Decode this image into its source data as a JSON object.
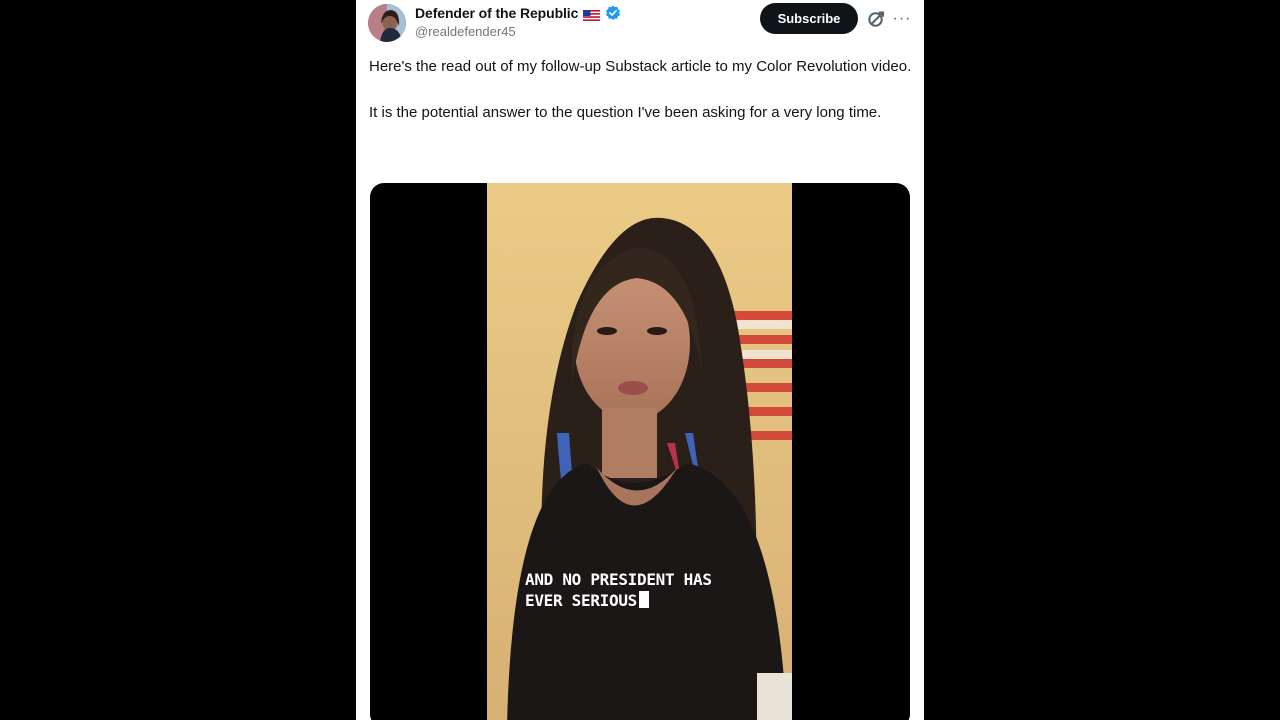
{
  "tweet": {
    "author": {
      "name": "Defender of the Republic",
      "handle": "@realdefender45",
      "verified": true,
      "flag_icon": "us-flag-icon",
      "verified_icon": "verified-badge-icon",
      "verified_color": "#1d9bf0"
    },
    "subscribe_label": "Subscribe",
    "grok_icon": "grok-icon",
    "more_label": "···",
    "text_paragraphs": [
      "Here's the read out of my follow-up Substack article to my Color Revolution video.",
      "It is the potential answer to the question I've been asking for a very long time."
    ],
    "media": {
      "caption_lines": [
        "AND NO PRESIDENT HAS",
        "EVER SERIOUS"
      ]
    }
  },
  "colors": {
    "page_background": "#000000",
    "card_background": "#ffffff",
    "text_primary": "#0f1419",
    "text_secondary": "#71767b",
    "subscribe_bg": "#0f1419"
  }
}
